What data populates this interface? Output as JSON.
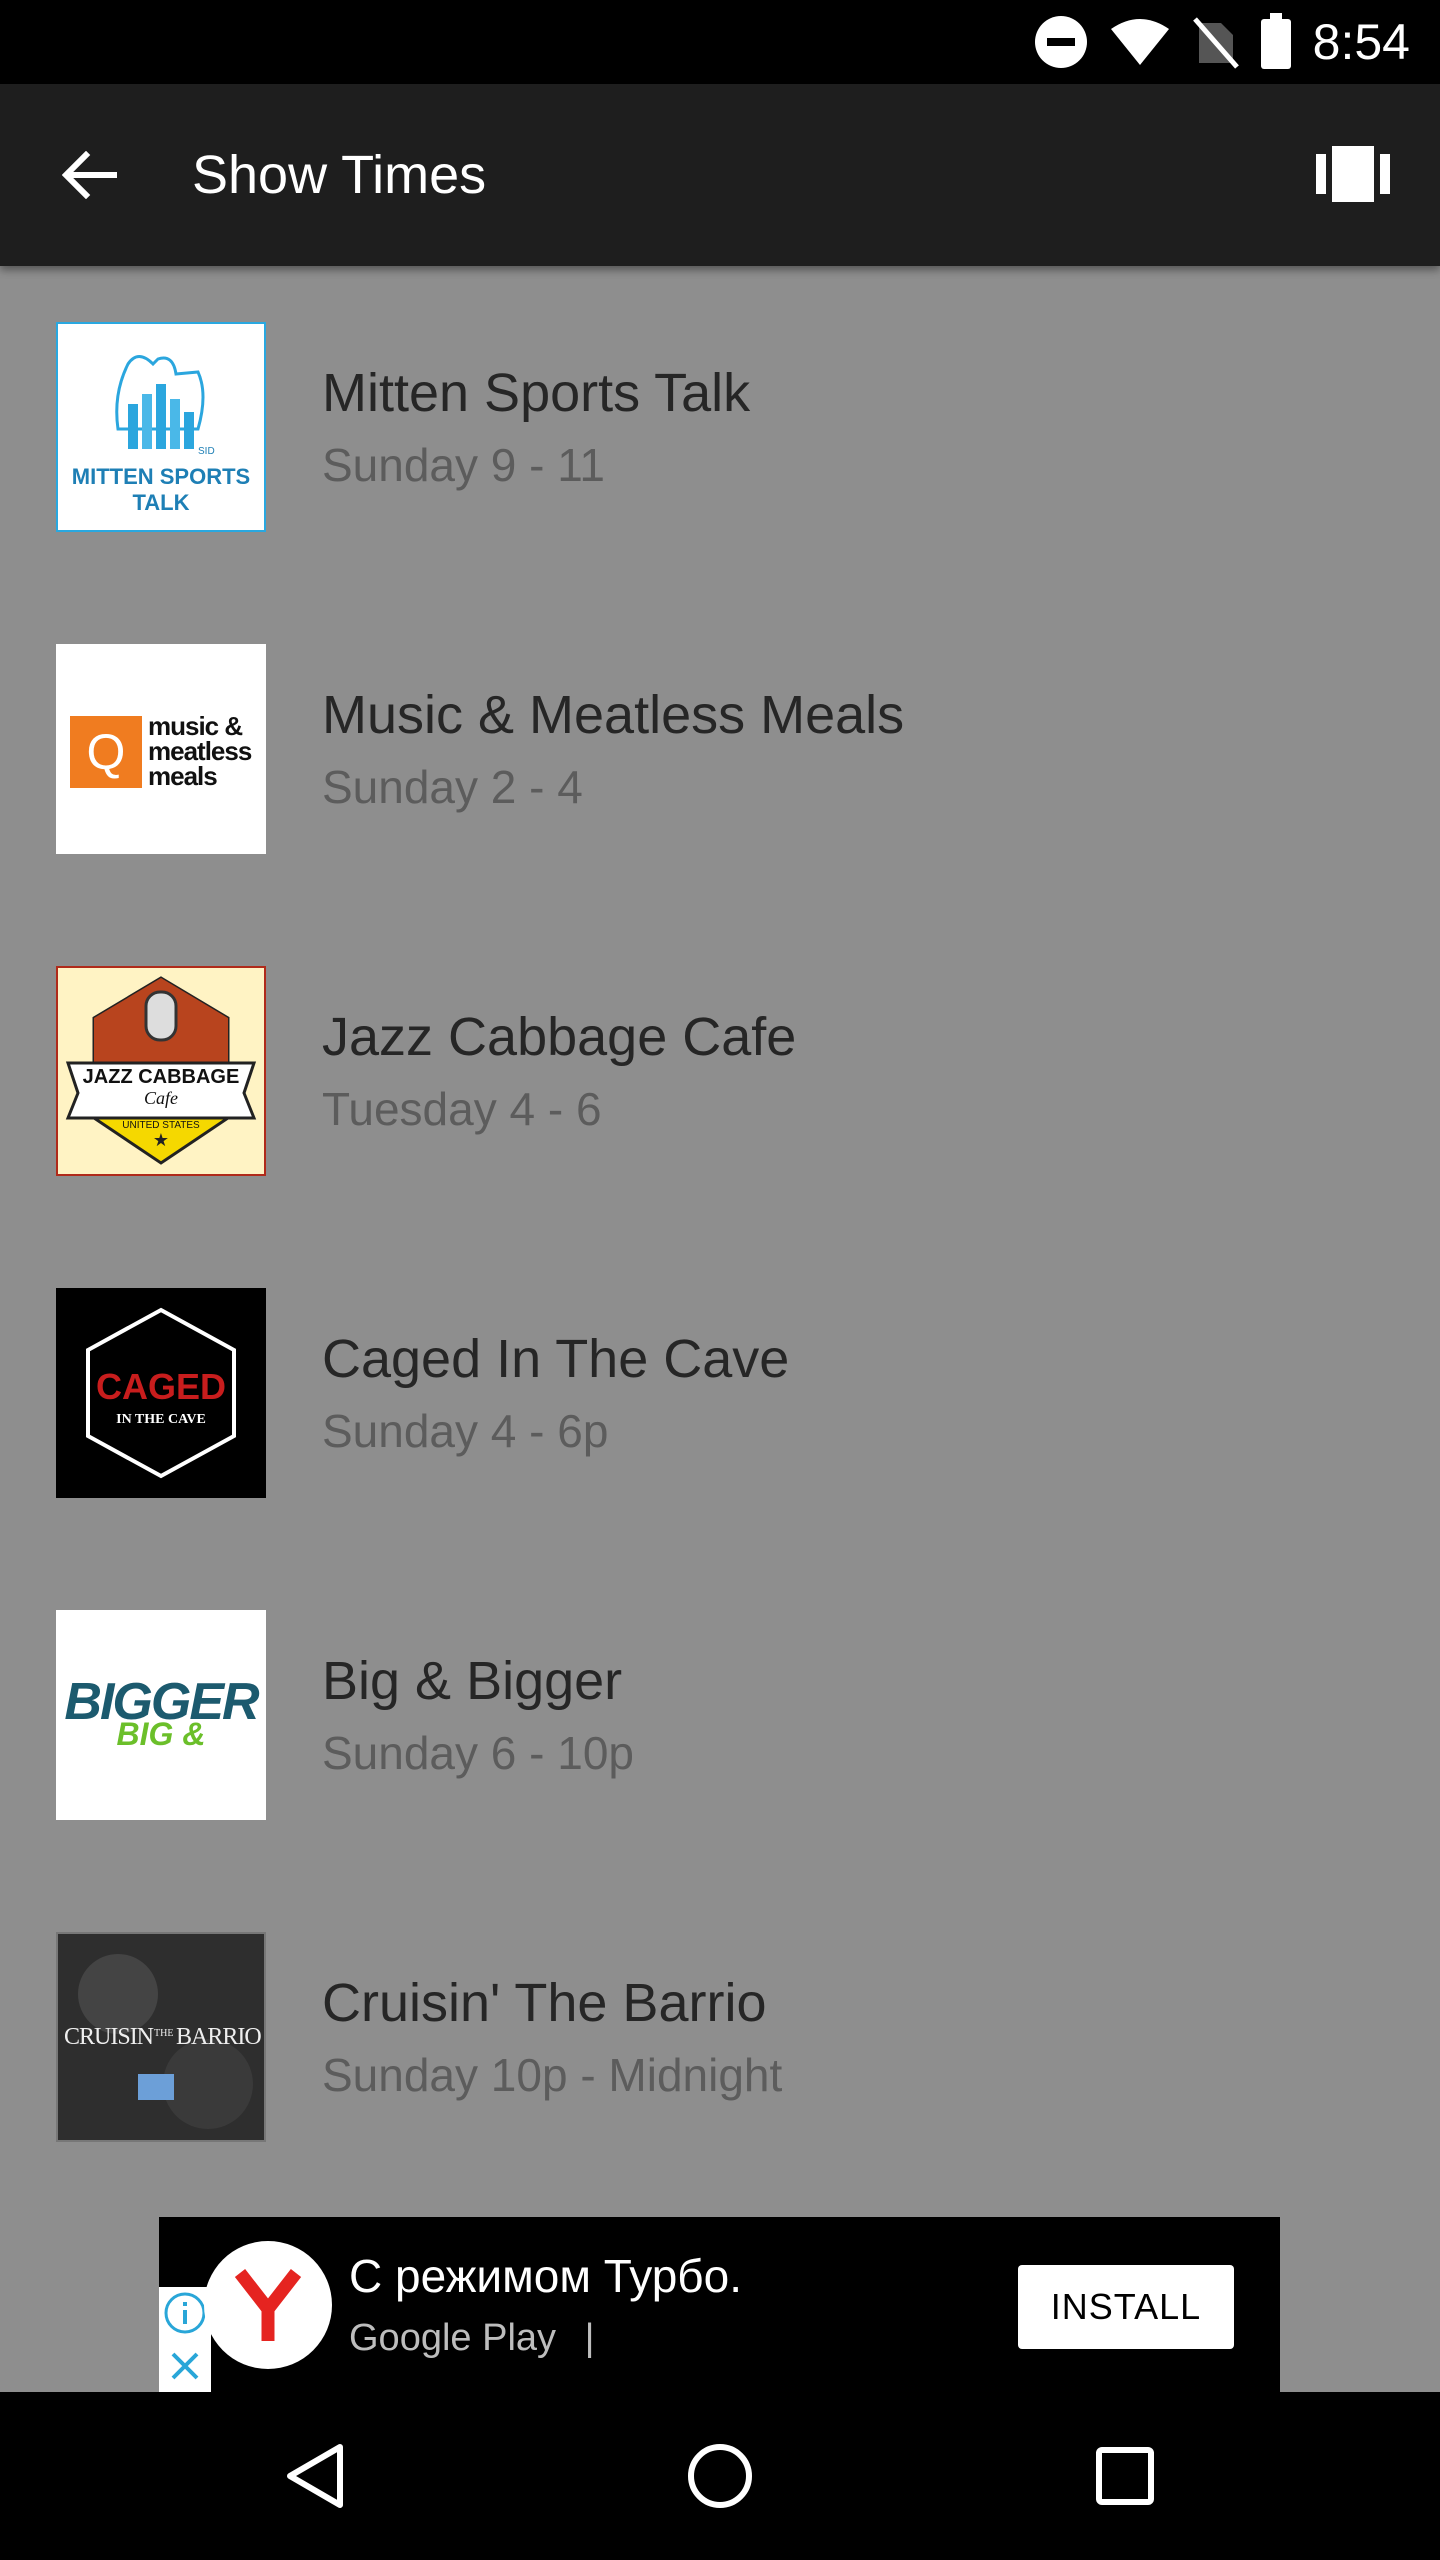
{
  "status_bar": {
    "time": "8:54",
    "icons": [
      "do-not-disturb-icon",
      "wifi-icon",
      "no-sim-icon",
      "battery-icon"
    ]
  },
  "app_bar": {
    "title": "Show Times",
    "back_icon": "arrow-back-icon",
    "action_icon": "cast-icon"
  },
  "shows": [
    {
      "title": "Mitten Sports Talk",
      "time": "Sunday 9 - 11",
      "logo_text": "MITTEN SPORTS TALK",
      "logo_badge": "SID"
    },
    {
      "title": "Music & Meatless Meals",
      "time": "Sunday 2 - 4",
      "logo_text": "music & meatless meals",
      "logo_letter": "Q"
    },
    {
      "title": "Jazz Cabbage Cafe",
      "time": "Tuesday 4 - 6",
      "logo_text": "JAZZ CABBAGE",
      "logo_sub": "Cafe",
      "logo_country": "UNITED STATES"
    },
    {
      "title": "Caged In The Cave",
      "time": "Sunday 4 - 6p",
      "logo_text": "CAGED",
      "logo_sub": "IN THE CAVE"
    },
    {
      "title": "Big & Bigger",
      "time": "Sunday 6 - 10p",
      "logo_text": "BIGGER",
      "logo_sub": "BIG &"
    },
    {
      "title": "Cruisin' The Barrio",
      "time": "Sunday 10p - Midnight",
      "logo_text": "CRUISIN",
      "logo_mid": "THE",
      "logo_text2": "BARRIO"
    }
  ],
  "ad": {
    "headline": "С режимом Турбо.",
    "source": "Google Play",
    "separator": "|",
    "install_label": "INSTALL"
  },
  "nav_bar": {
    "icons": [
      "back-triangle-icon",
      "home-circle-icon",
      "recents-square-icon"
    ]
  },
  "colors": {
    "list_background": "#8e8e8e",
    "app_bar": "#1e1e1e",
    "title_text": "#262626",
    "subtitle_text": "#5c5c5c"
  }
}
